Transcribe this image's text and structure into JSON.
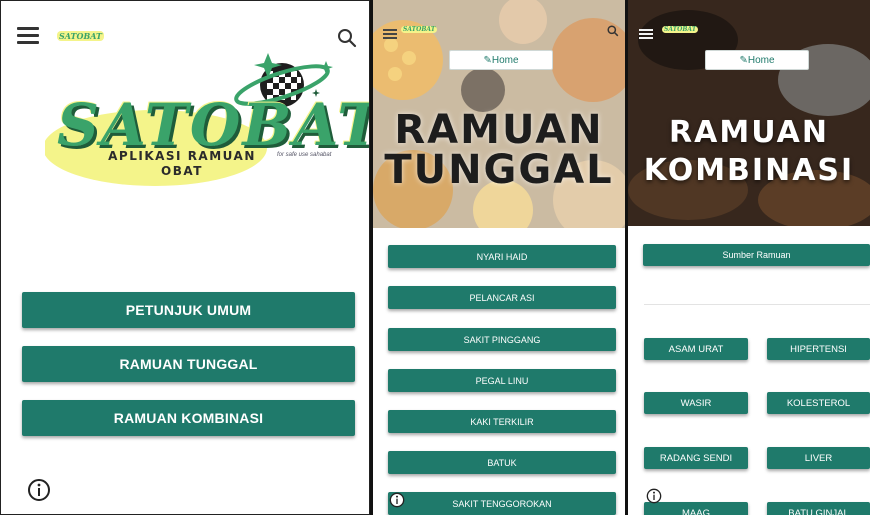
{
  "screen1": {
    "app_logo_small": "SATOBAT",
    "logo": {
      "title": "SATOBAT",
      "subtitle_line1": "APLIKASI RAMUAN",
      "subtitle_line2": "OBAT",
      "caption": "for safe use sahabat"
    },
    "buttons": [
      "PETUNJUK UMUM",
      "RAMUAN TUNGGAL",
      "RAMUAN KOMBINASI"
    ],
    "icons": {
      "menu": "menu-icon",
      "search": "search-icon",
      "info": "info-icon"
    }
  },
  "screen2": {
    "app_logo_small": "SATOBAT",
    "home_label": "✎Home",
    "title_line1": "RAMUAN",
    "title_line2": "TUNGGAL",
    "buttons": [
      "NYARI HAID",
      "PELANCAR ASI",
      "SAKIT PINGGANG",
      "PEGAL LINU",
      "KAKI TERKILIR",
      "BATUK",
      "SAKIT TENGGOROKAN"
    ]
  },
  "screen3": {
    "app_logo_small": "SATOBAT",
    "home_label": "✎Home",
    "title_line1": "RAMUAN",
    "title_line2": "KOMBINASI",
    "source_button": "Sumber Ramuan",
    "grid_buttons": [
      "ASAM URAT",
      "HIPERTENSI",
      "WASIR",
      "KOLESTEROL",
      "RADANG SENDI",
      "LIVER",
      "MAAG",
      "BATU GINJAL"
    ]
  },
  "colors": {
    "primary": "#1f7a6b",
    "logo_green": "#3aa36a",
    "logo_yellow": "#f4f48a"
  }
}
